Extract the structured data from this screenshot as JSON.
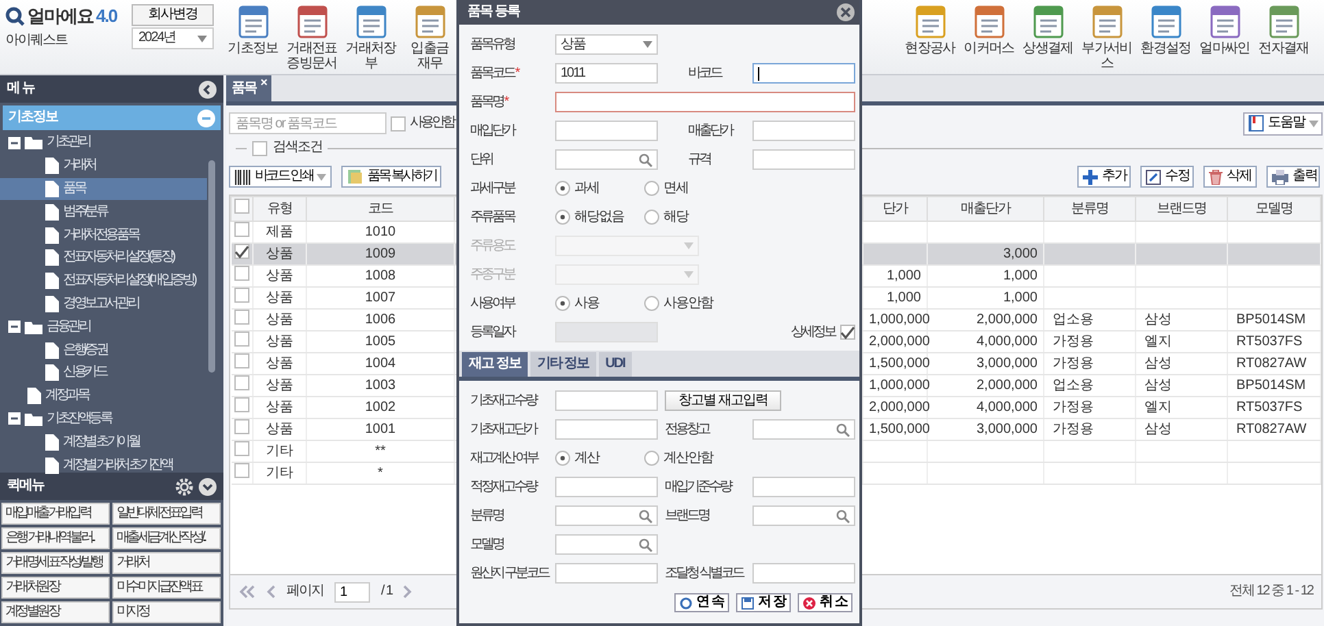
{
  "header": {
    "logo_name": "얼마에요",
    "logo_version": "4.0",
    "company_button": "회사변경",
    "company_name": "아이퀘스트",
    "year": "2024년",
    "toolbar": [
      {
        "label": "기초정보"
      },
      {
        "label": "거래전표\n증빙문서"
      },
      {
        "label": "거래처장부"
      },
      {
        "label": "입출금\n재무"
      }
    ],
    "toolbar_right": [
      {
        "label": "현장공사"
      },
      {
        "label": "이커머스"
      },
      {
        "label": "상생결제"
      },
      {
        "label": "부가서비스"
      },
      {
        "label": "환경설정"
      },
      {
        "label": "얼마싸인"
      },
      {
        "label": "전자결재"
      }
    ]
  },
  "sidebar": {
    "title": "메 뉴",
    "section": "기초정보",
    "tree": [
      {
        "label": "기초관리",
        "kind": "folder",
        "expanded": true,
        "selected": false,
        "children": [
          {
            "label": "거래처",
            "kind": "file",
            "selected": false
          },
          {
            "label": "품목",
            "kind": "file",
            "selected": true
          },
          {
            "label": "범주/분류",
            "kind": "file",
            "selected": false
          },
          {
            "label": "거래처전용품목",
            "kind": "file",
            "selected": false
          },
          {
            "label": "전표자동처리설정(통장)",
            "kind": "file",
            "selected": false
          },
          {
            "label": "전표자동처리설정(매입증빙)",
            "kind": "file",
            "selected": false
          },
          {
            "label": "경영보고서관리",
            "kind": "file",
            "selected": false
          }
        ]
      },
      {
        "label": "금융관리",
        "kind": "folder",
        "expanded": true,
        "selected": false,
        "children": [
          {
            "label": "은행/증권",
            "kind": "file",
            "selected": false
          },
          {
            "label": "신용카드",
            "kind": "file",
            "selected": false
          }
        ]
      },
      {
        "label": "계정과목",
        "kind": "file",
        "selected": false
      },
      {
        "label": "기초잔액등록",
        "kind": "folder",
        "expanded": true,
        "selected": false,
        "children": [
          {
            "label": "계정별 초기이월",
            "kind": "file",
            "selected": false
          },
          {
            "label": "계정별 거래처 초기잔액",
            "kind": "file",
            "selected": false
          }
        ]
      }
    ],
    "quick_title": "퀵메뉴",
    "quick_menu": [
      "매입매출거래입력",
      "일반대체전표입력",
      "은행 거래내역 불러...",
      "매출세금계산 작성/...",
      "거래명세표 작성/발행",
      "거래처",
      "거래처원장",
      "미수미지급잔액표",
      "계정별원장",
      "미지정"
    ]
  },
  "tab": {
    "label": "품목",
    "close": "×",
    "selected": true
  },
  "search": {
    "placeholder": "품목명 or 품목코드",
    "unused_label": "사용안함",
    "unused_checked": false,
    "filter_label": "검색조건",
    "filter_checked": false,
    "help": "도움말"
  },
  "actions_left": [
    {
      "label": "바코드 인쇄",
      "kind": "barcode"
    },
    {
      "label": "품목 복사하기",
      "kind": "copy"
    }
  ],
  "actions_right": [
    {
      "label": "추 가",
      "kind": "add"
    },
    {
      "label": "수 정",
      "kind": "edit"
    },
    {
      "label": "삭 제",
      "kind": "delete"
    },
    {
      "label": "출 력",
      "kind": "print"
    }
  ],
  "table": {
    "select_all_checked": false,
    "columns": [
      {
        "label": "유형"
      },
      {
        "label": "코드"
      },
      {
        "label": "단가"
      },
      {
        "label": "매출단가"
      },
      {
        "label": "분류명"
      },
      {
        "label": "브랜드명"
      },
      {
        "label": "모델명"
      }
    ],
    "rows": [
      {
        "checked": false,
        "selected": false,
        "type": "제품",
        "code": "1010"
      },
      {
        "checked": true,
        "selected": true,
        "type": "상품",
        "code": "1009",
        "sales": "3,000"
      },
      {
        "checked": false,
        "selected": false,
        "type": "상품",
        "code": "1008",
        "purchase": "1,000",
        "sales": "1,000"
      },
      {
        "checked": false,
        "selected": false,
        "type": "상품",
        "code": "1007",
        "purchase": "1,000",
        "sales": "1,000"
      },
      {
        "checked": false,
        "selected": false,
        "type": "상품",
        "code": "1006",
        "purchase": "1,000,000",
        "sales": "2,000,000",
        "category": "업소용",
        "brand": "삼성",
        "model": "BP5014SM"
      },
      {
        "checked": false,
        "selected": false,
        "type": "상품",
        "code": "1005",
        "purchase": "2,000,000",
        "sales": "4,000,000",
        "category": "가정용",
        "brand": "엘지",
        "model": "RT5037FS"
      },
      {
        "checked": false,
        "selected": false,
        "type": "상품",
        "code": "1004",
        "purchase": "1,500,000",
        "sales": "3,000,000",
        "category": "가정용",
        "brand": "삼성",
        "model": "RT0827AW"
      },
      {
        "checked": false,
        "selected": false,
        "type": "상품",
        "code": "1003",
        "purchase": "1,000,000",
        "sales": "2,000,000",
        "category": "업소용",
        "brand": "삼성",
        "model": "BP5014SM"
      },
      {
        "checked": false,
        "selected": false,
        "type": "상품",
        "code": "1002",
        "purchase": "2,000,000",
        "sales": "4,000,000",
        "category": "가정용",
        "brand": "엘지",
        "model": "RT5037FS"
      },
      {
        "checked": false,
        "selected": false,
        "type": "상품",
        "code": "1001",
        "purchase": "1,500,000",
        "sales": "3,000,000",
        "category": "가정용",
        "brand": "삼성",
        "model": "RT0827AW"
      },
      {
        "checked": false,
        "selected": false,
        "type": "기타",
        "code": "**"
      },
      {
        "checked": false,
        "selected": false,
        "type": "기타",
        "code": "*"
      }
    ]
  },
  "pager": {
    "page_label": "페이지",
    "page": "1",
    "total_pages": "/ 1",
    "summary": "전체 12 중 1 - 12"
  },
  "modal": {
    "title": "품목 등록",
    "form": [
      {
        "items": [
          {
            "label": "품목유형",
            "kind": "select",
            "value": "상품"
          }
        ]
      },
      {
        "items": [
          {
            "label": "품목코드",
            "mark": "*",
            "kind": "input",
            "value": "1011"
          },
          {
            "label": "바코드",
            "kind": "input",
            "focused": true
          }
        ]
      },
      {
        "items": [
          {
            "label": "품목명",
            "mark": "*",
            "kind": "input",
            "wide": true,
            "invalid": true
          }
        ]
      },
      {
        "items": [
          {
            "label": "매입단가",
            "kind": "input"
          },
          {
            "label": "매출단가",
            "kind": "input"
          }
        ]
      },
      {
        "items": [
          {
            "label": "단위",
            "kind": "search"
          },
          {
            "label": "규격",
            "kind": "input"
          }
        ]
      },
      {
        "items": [
          {
            "label": "과세구분",
            "kind": "radio",
            "options": [
              {
                "label": "과세",
                "selected": true
              },
              {
                "label": "면세",
                "selected": false
              }
            ]
          }
        ]
      },
      {
        "items": [
          {
            "label": "주류품목",
            "kind": "radio",
            "options": [
              {
                "label": "해당없음",
                "selected": true
              },
              {
                "label": "해당",
                "selected": false
              }
            ]
          }
        ]
      },
      {
        "items": [
          {
            "label": "주류용도",
            "kind": "select",
            "disabled": true
          }
        ]
      },
      {
        "items": [
          {
            "label": "주종구분",
            "kind": "select",
            "disabled": true
          }
        ]
      },
      {
        "items": [
          {
            "label": "사용여부",
            "kind": "radio",
            "options": [
              {
                "label": "사용",
                "selected": true
              },
              {
                "label": "사용안함",
                "selected": false
              }
            ]
          }
        ]
      },
      {
        "items": [
          {
            "label": "등록일자",
            "kind": "input",
            "disabled": true
          },
          {
            "label": "상세정보",
            "kind": "checkbox",
            "checked": true
          }
        ]
      }
    ],
    "tabs": [
      {
        "label": "재고 정보",
        "selected": true
      },
      {
        "label": "기타 정보",
        "selected": false
      },
      {
        "label": "UDI",
        "selected": false
      }
    ],
    "stock": [
      {
        "items": [
          {
            "label": "기초재고수량",
            "kind": "input"
          },
          {
            "label": "창고별 재고입력",
            "kind": "button"
          }
        ]
      },
      {
        "items": [
          {
            "label": "기초재고단가",
            "kind": "input"
          },
          {
            "label": "전용창고",
            "kind": "search"
          }
        ]
      },
      {
        "items": [
          {
            "label": "재고계산 여부",
            "kind": "radio",
            "options": [
              {
                "label": "계산",
                "selected": true
              },
              {
                "label": "계산안함",
                "selected": false
              }
            ]
          }
        ]
      },
      {
        "items": [
          {
            "label": "적정재고수량",
            "kind": "input"
          },
          {
            "label": "매입기준수량",
            "kind": "input"
          }
        ]
      },
      {
        "items": [
          {
            "label": "분류명",
            "kind": "search"
          },
          {
            "label": "브랜드명",
            "kind": "search"
          }
        ]
      },
      {
        "items": [
          {
            "label": "모델명",
            "kind": "search"
          }
        ]
      },
      {
        "items": [
          {
            "label": "원산지 구분코드",
            "kind": "input"
          },
          {
            "label": "조달청 식별코드",
            "kind": "input"
          }
        ]
      }
    ],
    "buttons": [
      {
        "label": "연 속",
        "kind": "continue"
      },
      {
        "label": "저 장",
        "kind": "save"
      },
      {
        "label": "취 소",
        "kind": "cancel"
      }
    ]
  }
}
